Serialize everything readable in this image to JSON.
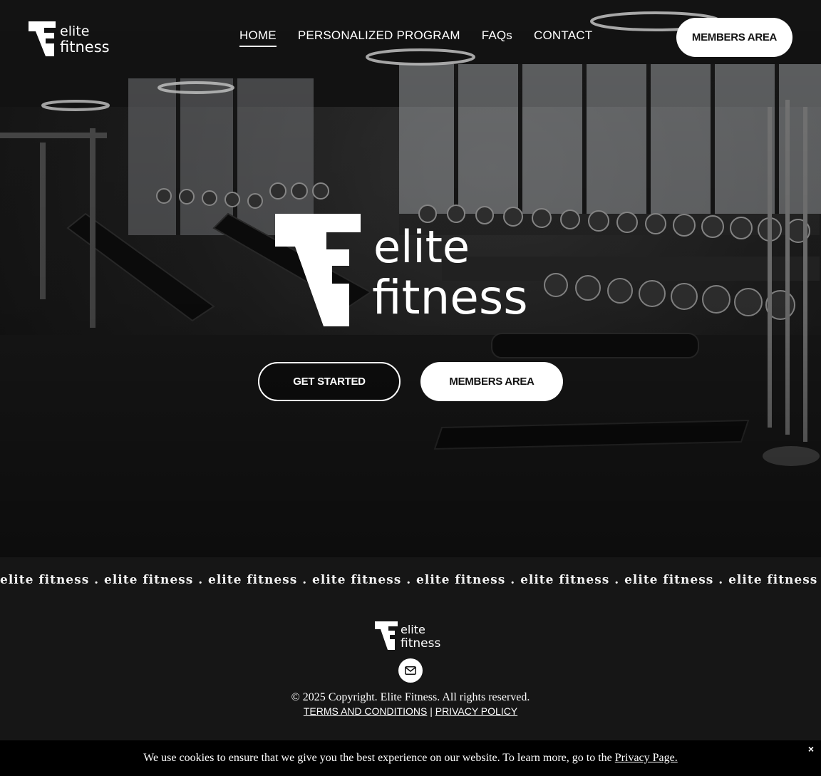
{
  "brand": {
    "line1": "elite",
    "line2": "fitness"
  },
  "nav": {
    "items": [
      {
        "label": "HOME",
        "active": true
      },
      {
        "label": "PERSONALIZED PROGRAM",
        "active": false
      },
      {
        "label": "FAQs",
        "active": false
      },
      {
        "label": "CONTACT",
        "active": false
      }
    ],
    "members_label": "MEMBERS AREA"
  },
  "hero": {
    "get_started_label": "GET STARTED",
    "members_label": "MEMBERS AREA"
  },
  "marquee": {
    "unit": "elite fitness . "
  },
  "footer": {
    "email_icon": "envelope-icon",
    "copyright": "© 2025 Copyright. Elite Fitness. All rights reserved.",
    "terms": "TERMS AND CONDITIONS",
    "separator": "|",
    "privacy": "PRIVACY POLICY"
  },
  "cookie": {
    "text": "We use cookies to ensure that we give you the best experience on our website. To learn more, go to the",
    "link": "Privacy Page.",
    "close": "×"
  },
  "colors": {
    "background": "#161616",
    "white": "#ffffff",
    "cookie_bg": "#000000"
  }
}
